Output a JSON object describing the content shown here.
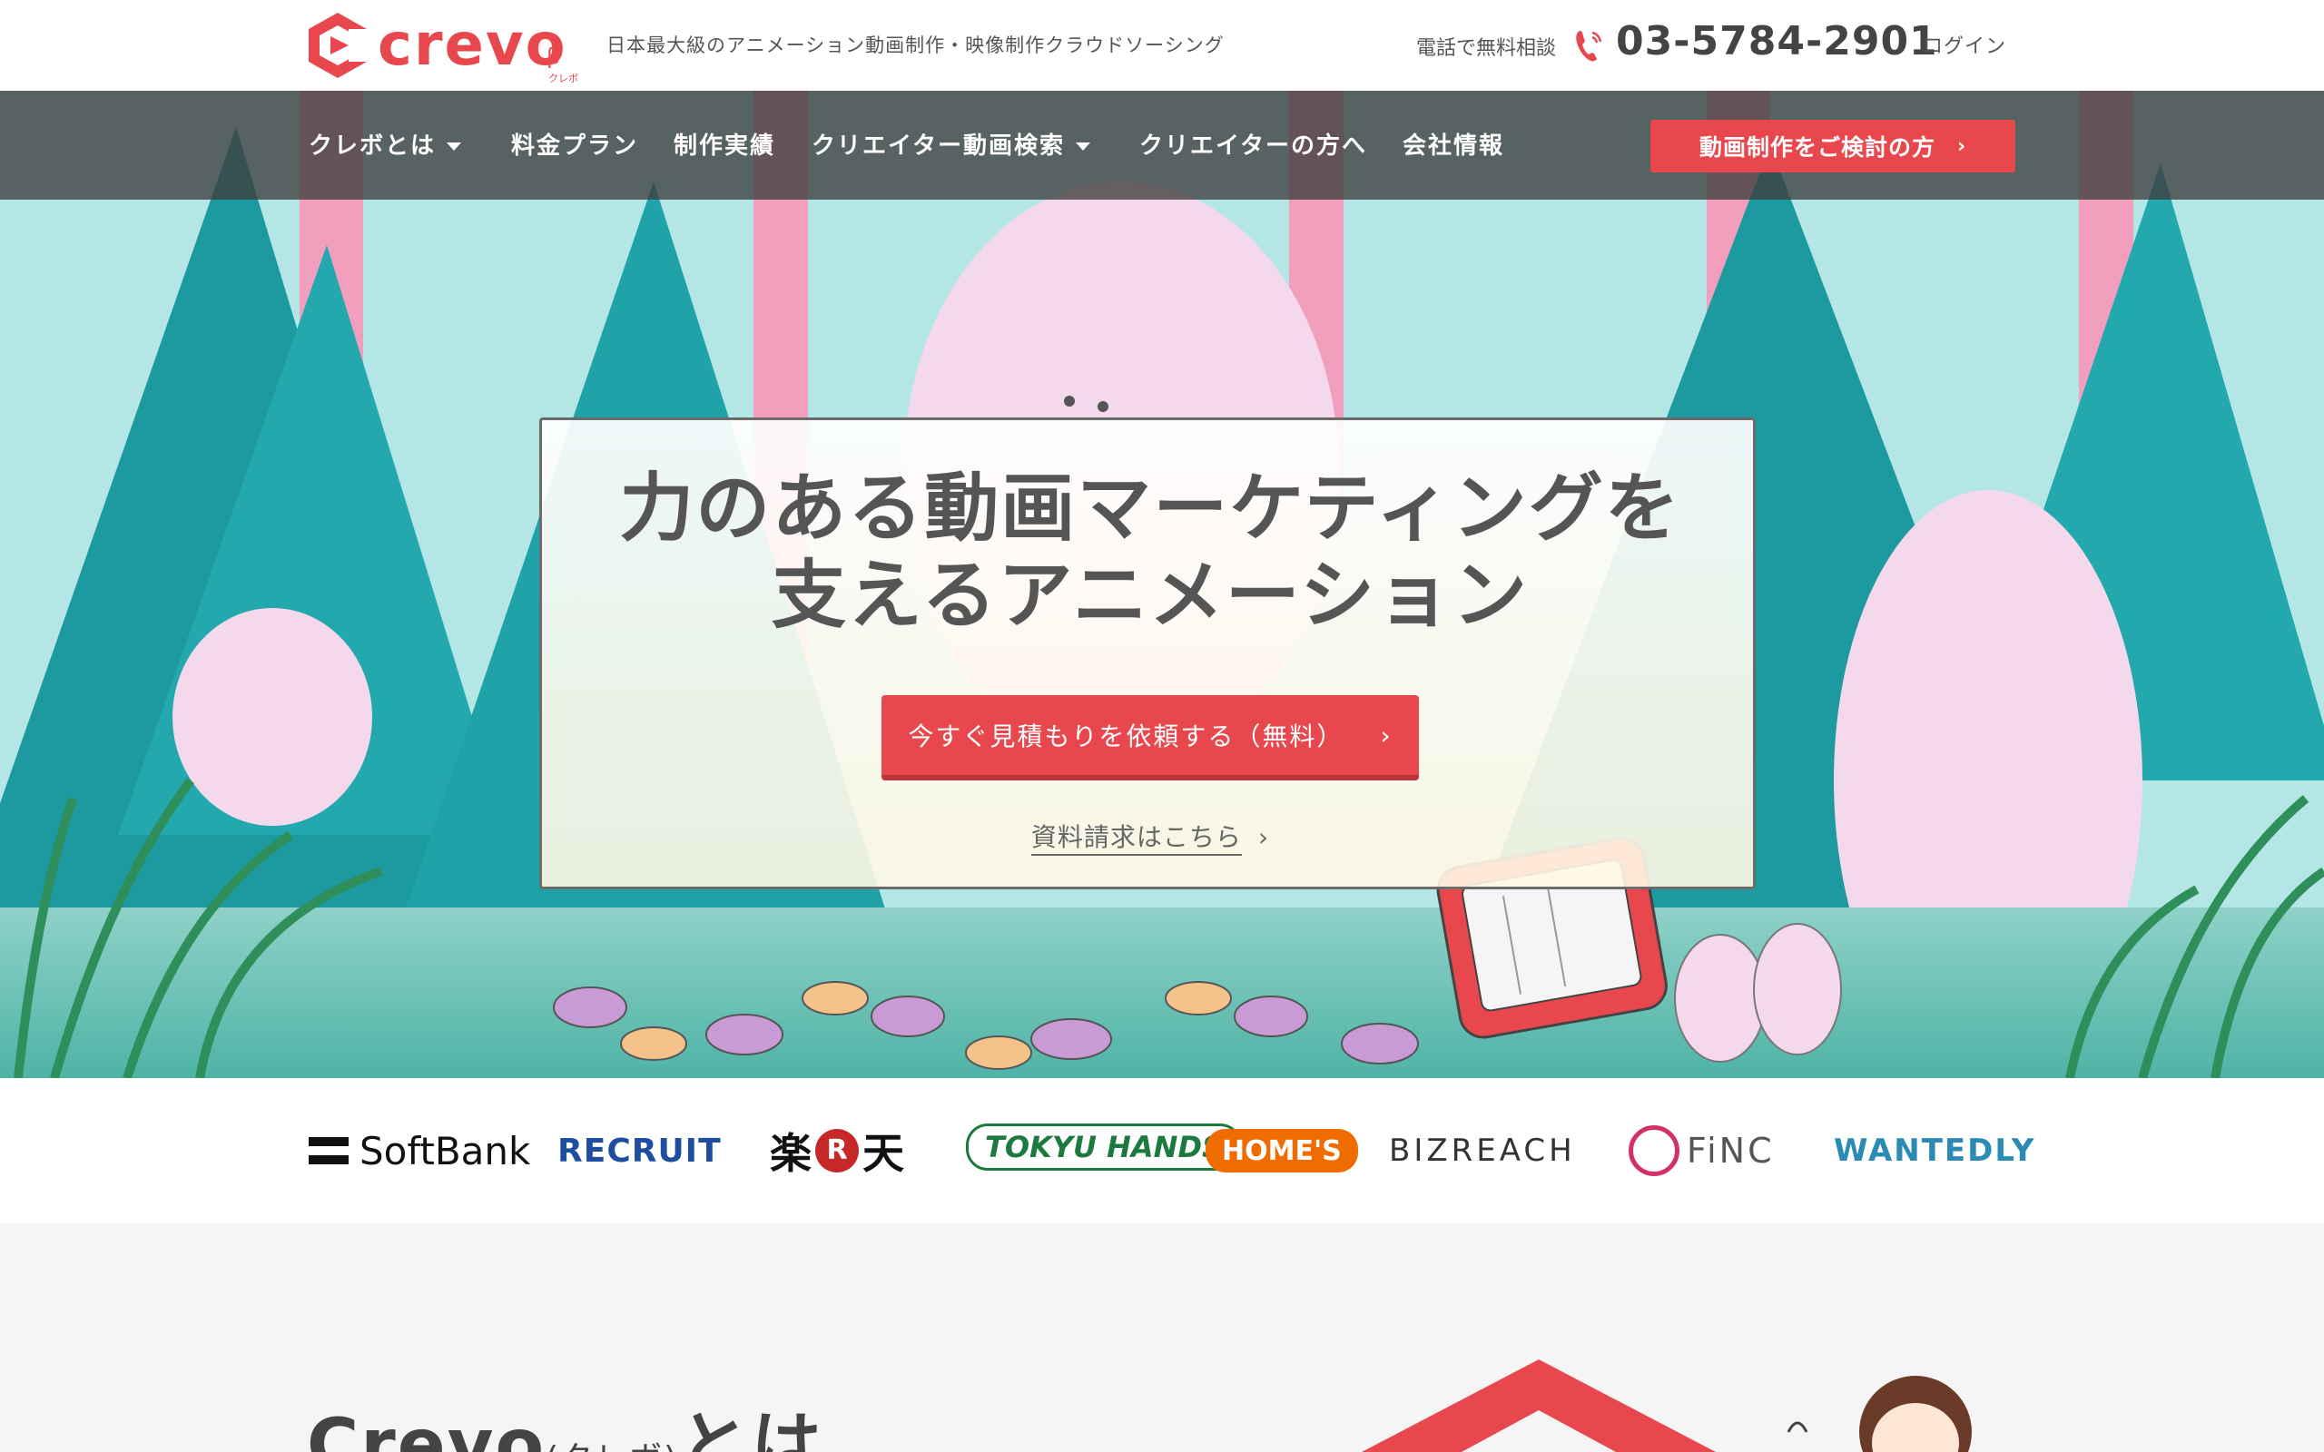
{
  "header": {
    "logo_text": "crevo",
    "logo_beta": "β",
    "logo_kana": "クレボ",
    "tagline": "日本最大級のアニメーション動画制作・映像制作クラウドソーシング",
    "tel_label": "電話で無料相談",
    "tel_number": "03-5784-2901",
    "login": "ログイン"
  },
  "nav": {
    "items": [
      {
        "label": "クレボとは",
        "dropdown": true
      },
      {
        "label": "料金プラン",
        "dropdown": false
      },
      {
        "label": "制作実績",
        "dropdown": false
      },
      {
        "label": "クリエイター動画検索",
        "dropdown": true
      },
      {
        "label": "クリエイターの方へ",
        "dropdown": false
      },
      {
        "label": "会社情報",
        "dropdown": false
      }
    ],
    "cta_label": "動画制作をご検討の方",
    "cta_chevron": "›"
  },
  "hero": {
    "headline_line1": "力のある動画マーケティングを",
    "headline_line2": "支えるアニメーション",
    "cta_label": "今すぐ見積もりを依頼する（無料）",
    "cta_chevron": "›",
    "doc_link": "資料請求はこちら",
    "doc_chevron": "›"
  },
  "clients": {
    "softbank": "SoftBank",
    "recruit": "RECRUIT",
    "rakuten_left": "楽",
    "rakuten_mid": "R",
    "rakuten_right": "天",
    "tokyu": "TOKYU HANDS",
    "homes": "HOME'S",
    "bizreach": "BIZREACH",
    "finc": "FiNC",
    "wantedly": "WANTEDLY"
  },
  "about": {
    "title_main": "Crevo",
    "title_sub": "(クレボ)",
    "title_tail": "とは"
  },
  "colors": {
    "brand_red": "#e8484d",
    "nav_bg": "#3c3c3c",
    "teal": "#1fa3a8",
    "sky": "#b5e6e6"
  }
}
